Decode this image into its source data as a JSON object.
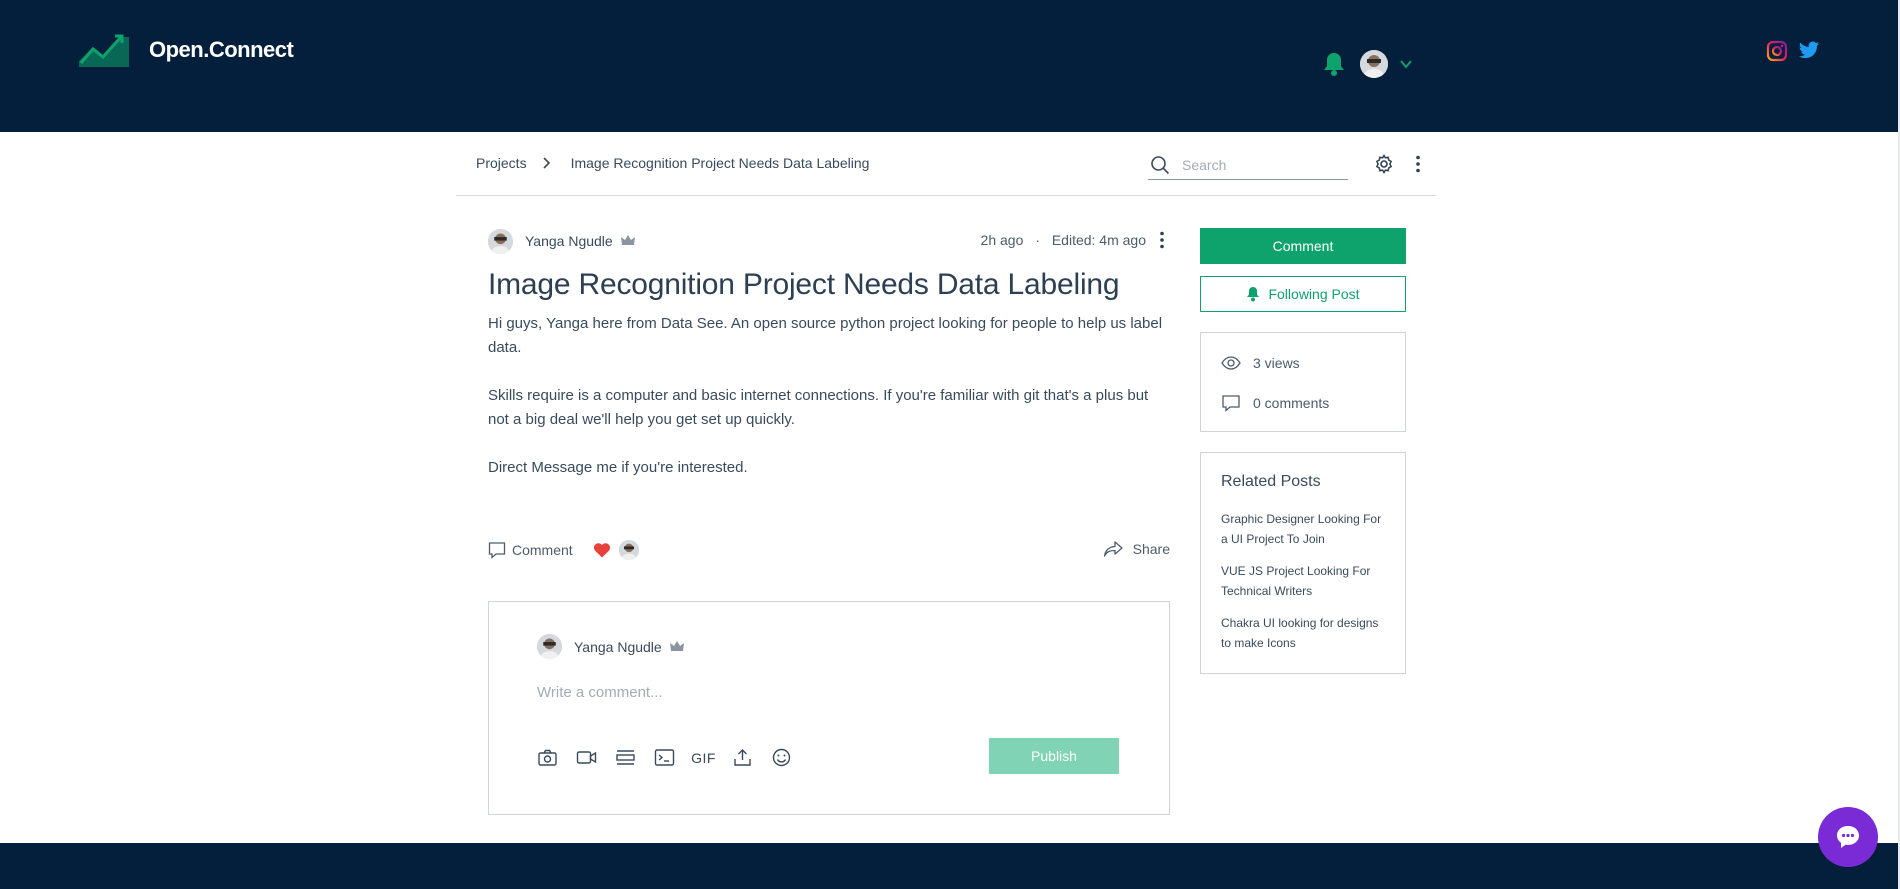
{
  "brand": {
    "name": "Open.Connect",
    "logo_icon": "trend-chart-logo-icon",
    "accent_color": "#0ea26d",
    "header_bg": "#041f3b"
  },
  "header": {
    "notification_icon": "bell-icon",
    "user_menu_icon": "chevron-down-icon",
    "socials": [
      {
        "icon": "instagram-icon"
      },
      {
        "icon": "twitter-icon"
      }
    ]
  },
  "subnav": {
    "breadcrumb": {
      "root": "Projects",
      "current": "Image Recognition Project Needs Data Labeling"
    },
    "search": {
      "placeholder": "Search",
      "value": ""
    },
    "settings_icon": "gear-icon",
    "more_icon": "kebab-icon"
  },
  "post": {
    "author": "Yanga Ngudle",
    "author_badge_icon": "crown-icon",
    "posted": "2h ago",
    "separator": "·",
    "edited": "Edited: 4m ago",
    "title": "Image Recognition Project Needs Data Labeling",
    "paragraphs": [
      "Hi guys, Yanga here from Data See. An open source python project looking for people to help us label data.",
      "Skills require is a computer and basic internet connections. If you're familiar with git that's a plus but not a big deal we'll help you get set up quickly.",
      "Direct Message me if you're interested."
    ],
    "actions": {
      "comment_label": "Comment",
      "like_icon": "heart-icon",
      "share_label": "Share"
    }
  },
  "comment_box": {
    "author": "Yanga Ngudle",
    "placeholder": "Write a comment...",
    "value": "",
    "tools": [
      {
        "icon": "camera-icon"
      },
      {
        "icon": "video-icon"
      },
      {
        "icon": "divider-icon"
      },
      {
        "icon": "code-block-icon"
      },
      {
        "icon": "gif-icon",
        "label": "GIF"
      },
      {
        "icon": "upload-icon"
      },
      {
        "icon": "emoji-icon"
      }
    ],
    "publish_label": "Publish"
  },
  "sidebar": {
    "comment_button": "Comment",
    "follow_button": "Following Post",
    "stats": {
      "views": "3 views",
      "comments": "0 comments"
    },
    "related": {
      "title": "Related Posts",
      "items": [
        "Graphic Designer Looking For a UI Project To Join",
        "VUE JS Project Looking For Technical Writers",
        "Chakra UI looking for designs to make Icons"
      ]
    }
  },
  "chat": {
    "icon": "chat-bubble-icon",
    "color": "#7a2bd6"
  }
}
